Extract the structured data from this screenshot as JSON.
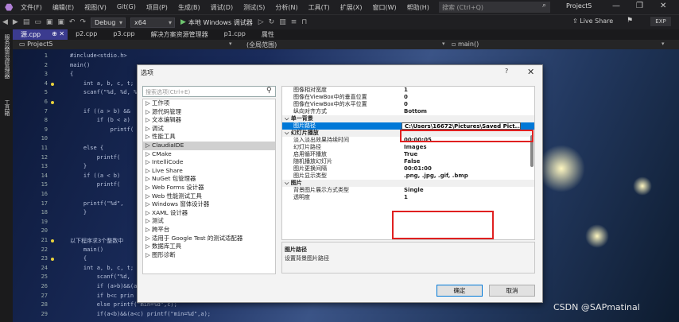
{
  "menu": {
    "items": [
      "文件(F)",
      "编辑(E)",
      "视图(V)",
      "Git(G)",
      "项目(P)",
      "生成(B)",
      "调试(D)",
      "测试(S)",
      "分析(N)",
      "工具(T)",
      "扩展(X)",
      "窗口(W)",
      "帮助(H)"
    ],
    "search_placeholder": "搜索 (Ctrl+Q)",
    "project_title": "Project5"
  },
  "toolbar": {
    "config": "Debug",
    "platform": "x64",
    "run_label": "本地 Windows 调试器",
    "live_share": "Live Share",
    "exp": "EXP"
  },
  "side_strip": {
    "top": "服务器资源管理器",
    "bottom": "工具箱"
  },
  "tabs": [
    "源.cpp",
    "p2.cpp",
    "p3.cpp",
    "解决方案资源管理器",
    "p1.cpp",
    "属性"
  ],
  "navbar": {
    "project": "Project5",
    "scope": "(全局范围)",
    "function": "main()"
  },
  "editor": {
    "line_numbers": [
      "1",
      "2",
      "3",
      "4",
      "5",
      "6",
      "7",
      "8",
      "9",
      "10",
      "11",
      "12",
      "13",
      "14",
      "15",
      "16",
      "17",
      "18",
      "19",
      "20",
      "21",
      "22",
      "23",
      "24",
      "25",
      "26",
      "27",
      "28",
      "29"
    ],
    "lines": [
      "#include<stdio.h>",
      "main()",
      "{",
      "    int a, b, c, t;",
      "    scanf(\"%d, %d, %d",
      "",
      "    if ((a > b) &&",
      "        if (b < a)",
      "            printf(",
      "",
      "    else {",
      "        printf(",
      "    }",
      "    if ((a < b)",
      "        printf(",
      "",
      "    printf(\"%d\",",
      "    }",
      "",
      "",
      "以下程序求3个整数中",
      "    main()",
      "    {",
      "    int a, b, c, t;",
      "        scanf(\"%d,",
      "        if (a>b)&&(a",
      "        if b<c prin",
      "        else printf(\"min=%d\",c);",
      "        if(a<b)&&(a<c) printf(\"min=%d\",a);"
    ]
  },
  "dialog": {
    "title": "选项",
    "help": "?",
    "search_placeholder": "搜索选项(Ctrl+E)",
    "tree": [
      "▷ 工作项",
      "▷ 源代码管理",
      "▷ 文本编辑器",
      "▷ 调试",
      "▷ 性能工具",
      "▷ ClaudiaIDE",
      "▷ CMake",
      "▷ IntelliCode",
      "▷ Live Share",
      "▷ NuGet 包管理器",
      "▷ Web Forms 设计器",
      "▷ Web 性能测试工具",
      "▷ Windows 窗体设计器",
      "▷ XAML 设计器",
      "▷ 测试",
      "▷ 跨平台",
      "▷ 适用于 Google Test 的测试适配器",
      "▷ 数据库工具",
      "▷ 图形诊断"
    ],
    "tree_selected": 5,
    "props": [
      {
        "name": "图像相对宽度",
        "value": "1",
        "type": "row"
      },
      {
        "name": "图像在ViewBox中的垂直位置",
        "value": "0",
        "type": "row"
      },
      {
        "name": "图像在ViewBox中的水平位置",
        "value": "0",
        "type": "row"
      },
      {
        "name": "纵向对齐方式",
        "value": "Bottom",
        "type": "row"
      },
      {
        "name": "单一背景",
        "value": "",
        "type": "cat"
      },
      {
        "name": "图片路径",
        "value": "C:\\Users\\16672\\Pictures\\Saved Pict...",
        "type": "hl"
      },
      {
        "name": "幻灯片播放",
        "value": "",
        "type": "cat"
      },
      {
        "name": "淡入淡出效果持续时间",
        "value": "00:00:05",
        "type": "row"
      },
      {
        "name": "幻灯片路径",
        "value": "Images",
        "type": "row"
      },
      {
        "name": "启用循环播放",
        "value": "True",
        "type": "row"
      },
      {
        "name": "随机播放幻灯片",
        "value": "False",
        "type": "row"
      },
      {
        "name": "图片更换间隔",
        "value": "00:01:00",
        "type": "row"
      },
      {
        "name": "图片显示类型",
        "value": ".png, .jpg, .gif, .bmp",
        "type": "row"
      },
      {
        "name": "图片",
        "value": "",
        "type": "cat"
      },
      {
        "name": "背景图片展示方式类型",
        "value": "Single",
        "type": "row"
      },
      {
        "name": "透明度",
        "value": "1",
        "type": "row"
      }
    ],
    "desc_title": "图片路径",
    "desc_text": "设置背景图片路径",
    "ok": "确定",
    "cancel": "取消"
  },
  "watermark": "CSDN @SAPmatinal",
  "colors": {
    "accent": "#0078d7",
    "highlight_box": "#e02020",
    "active_tab": "#3b3b8f"
  }
}
